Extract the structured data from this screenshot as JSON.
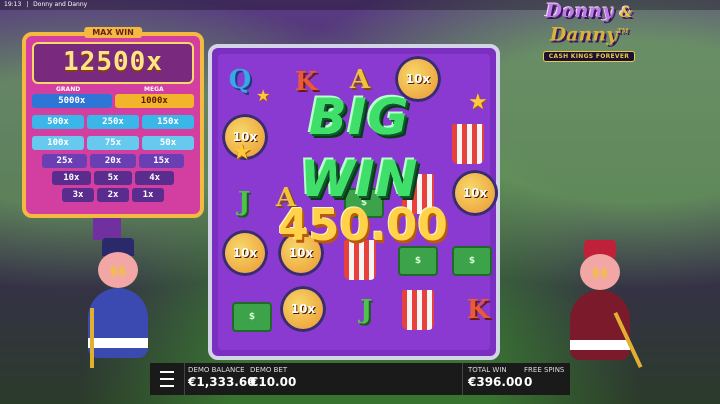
{
  "status_bar": {
    "time": "19:13",
    "separator": "|",
    "app_title": "Donny and Danny"
  },
  "logo": {
    "line1": "Donny",
    "ampersand": "&",
    "line2": "Danny",
    "tm": "TM",
    "tagline": "CASH KINGS FOREVER"
  },
  "jackpot": {
    "max_win_label": "MAX WIN",
    "max_win_value": "12500x",
    "grand_label": "GRAND",
    "mega_label": "MEGA",
    "rows": [
      [
        "5000x",
        "1000x"
      ],
      [
        "500x",
        "250x",
        "150x"
      ],
      [
        "100x",
        "75x",
        "50x"
      ],
      [
        "25x",
        "20x",
        "15x"
      ],
      [
        "10x",
        "5x",
        "4x"
      ],
      [
        "3x",
        "2x",
        "1x"
      ]
    ]
  },
  "reels": {
    "symbols": {
      "q": "Q",
      "k": "K",
      "a": "A",
      "j": "J",
      "mult": "10x",
      "cash": "$"
    }
  },
  "win_banner": {
    "title": "BIG WIN",
    "amount": "450.00"
  },
  "bottom_bar": {
    "balance_label": "DEMO BALANCE",
    "balance_value": "€1,333.60",
    "bet_label": "DEMO BET",
    "bet_value": "€10.00",
    "total_win_label": "TOTAL WIN",
    "total_win_value": "€396.00",
    "free_spins_label": "FREE SPINS",
    "free_spins_value": "0"
  },
  "colors": {
    "reel_bg": "#8a3ad0",
    "bigwin": "#3fe06a",
    "amount": "#ffd24a",
    "board": "#d33fa0",
    "frame": "#f4b940"
  }
}
